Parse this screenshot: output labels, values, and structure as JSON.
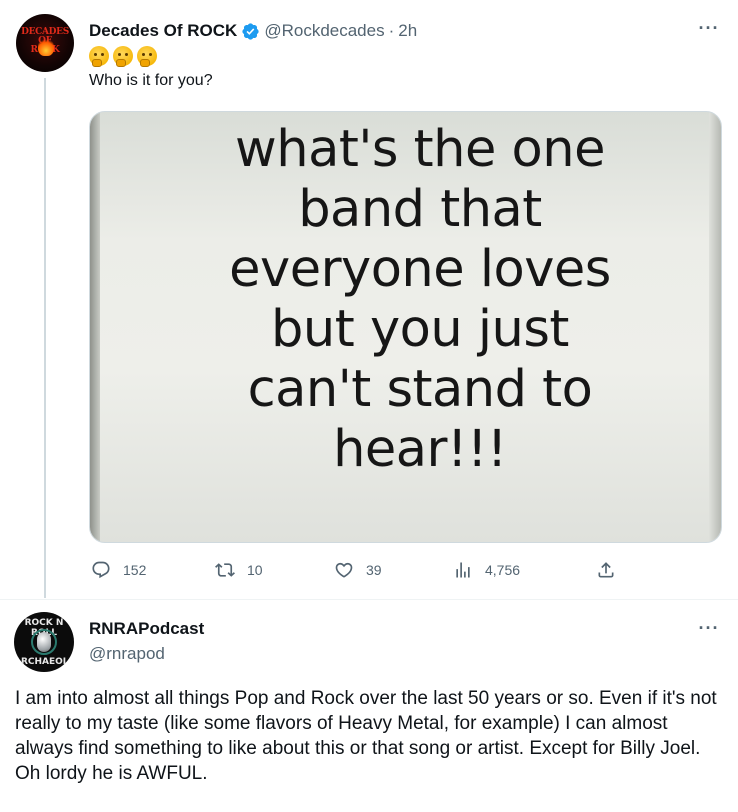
{
  "tweet1": {
    "display_name": "Decades Of ROCK",
    "handle": "@Rockdecades",
    "separator": "·",
    "time": "2h",
    "emojis": [
      "thinking-face",
      "thinking-face",
      "thinking-face"
    ],
    "text": "Who is it for you?",
    "avatar_text": [
      "DECADES",
      "OF",
      "ROCK"
    ],
    "image_text": "what's the one band that everyone loves but you just can't stand to hear!!!",
    "image_lines": [
      "what's the one",
      "band that",
      "everyone loves",
      "but you just",
      "can't stand to",
      "hear!!!"
    ],
    "actions": {
      "replies": "152",
      "retweets": "10",
      "likes": "39",
      "views": "4,756"
    },
    "more_label": "···"
  },
  "tweet2": {
    "display_name": "RNRAPodcast",
    "handle": "@rnrapod",
    "avatar_text": [
      "ROCK N ROLL",
      "ARCHAEOLOGY"
    ],
    "text": "I am into almost all things Pop and Rock over the last 50 years or so. Even if it's not really to my taste (like some flavors of Heavy Metal, for example) I can almost always find something to like about this or that song or artist. Except for Billy Joel. Oh lordy he is AWFUL.",
    "more_label": "···"
  },
  "colors": {
    "text": "#0f1419",
    "secondary": "#536471",
    "verified": "#1d9bf0",
    "thread_line": "#cfd9de"
  },
  "icons": [
    "reply-icon",
    "retweet-icon",
    "like-icon",
    "views-icon",
    "share-icon",
    "verified-badge-icon",
    "more-icon"
  ]
}
